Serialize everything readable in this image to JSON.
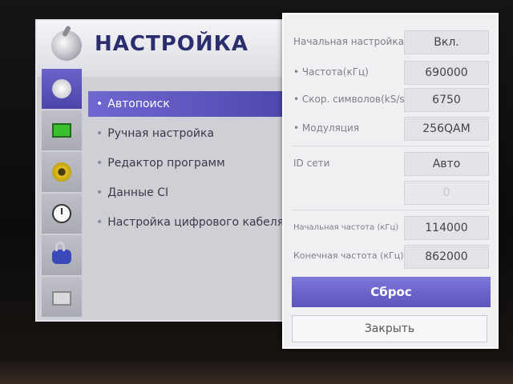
{
  "header": {
    "title": "НАСТРОЙКА",
    "icon": "satellite-dish-icon"
  },
  "sidebar": {
    "items": [
      {
        "icon": "satellite-dish-icon",
        "active": true
      },
      {
        "icon": "tv-screen-icon"
      },
      {
        "icon": "speaker-icon"
      },
      {
        "icon": "clock-icon"
      },
      {
        "icon": "lock-icon"
      },
      {
        "icon": "briefcase-icon"
      }
    ]
  },
  "menu": {
    "items": [
      {
        "label": "Автопоиск",
        "active": true
      },
      {
        "label": "Ручная настройка"
      },
      {
        "label": "Редактор программ"
      },
      {
        "label": "Данные CI"
      },
      {
        "label": "Настройка цифрового кабеля"
      }
    ]
  },
  "panel": {
    "initial_setup": {
      "label": "Начальная настройка",
      "value": "Вкл."
    },
    "frequency": {
      "label": "Частота(кГц)",
      "value": "690000"
    },
    "symbol_rate": {
      "label": "Скор. символов(kS/s)",
      "value": "6750"
    },
    "modulation": {
      "label": "Модуляция",
      "value": "256QAM"
    },
    "network_id": {
      "label": "ID сети",
      "value": "Авто",
      "value2": "0"
    },
    "start_freq": {
      "label": "Начальная частота (кГц)",
      "value": "114000"
    },
    "end_freq": {
      "label": "Конечная частота (кГц)",
      "value": "862000"
    },
    "reset_label": "Сброс",
    "close_label": "Закрыть"
  },
  "colors": {
    "accent": "#5b55bd",
    "title": "#2a2d6e"
  }
}
